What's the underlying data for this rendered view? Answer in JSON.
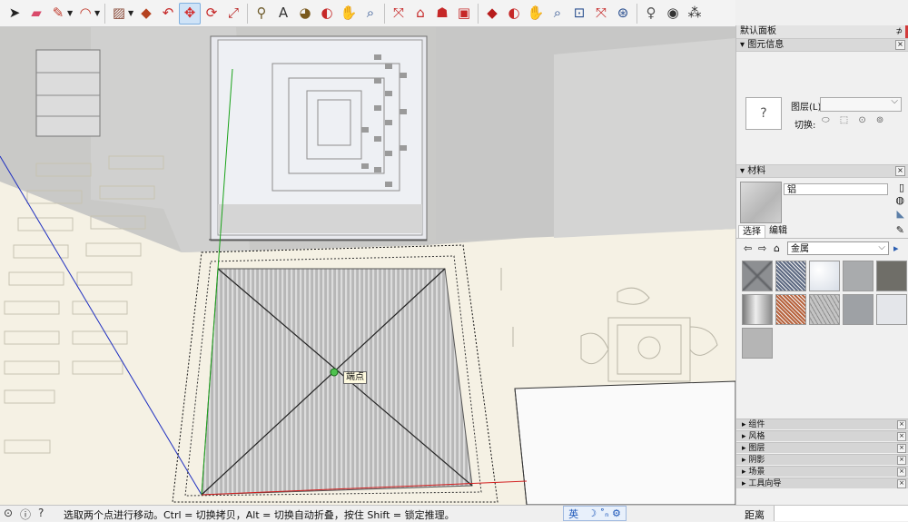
{
  "toolbar": {
    "tools": [
      {
        "name": "select-tool",
        "glyph": "➤",
        "color": "#222222"
      },
      {
        "name": "eraser-tool",
        "glyph": "▰",
        "color": "#d94a6a"
      },
      {
        "name": "pencil-tool",
        "glyph": "✎",
        "color": "#c0392b",
        "dropdown": true
      },
      {
        "name": "arc-tool",
        "glyph": "◠",
        "color": "#c0392b",
        "dropdown": true
      },
      {
        "name": "rectangle-tool",
        "glyph": "▨",
        "color": "#8a4b3a",
        "dropdown": true
      },
      {
        "name": "push-pull-tool",
        "glyph": "◆",
        "color": "#b5421f"
      },
      {
        "name": "offset-tool",
        "glyph": "↶",
        "color": "#c62828"
      },
      {
        "name": "move-tool",
        "glyph": "✥",
        "color": "#d32f2f",
        "active": true
      },
      {
        "name": "rotate-tool",
        "glyph": "⟳",
        "color": "#c62828"
      },
      {
        "name": "scale-tool",
        "glyph": "⤢",
        "color": "#b71c1c"
      },
      {
        "name": "tape-measure-tool",
        "glyph": "⚲",
        "color": "#6d5a2a"
      },
      {
        "name": "text-tool",
        "glyph": "A",
        "color": "#333333"
      },
      {
        "name": "paint-bucket-tool",
        "glyph": "◕",
        "color": "#7a5a1e"
      },
      {
        "name": "orbit-tool",
        "glyph": "◐",
        "color": "#c62828"
      },
      {
        "name": "pan-tool",
        "glyph": "✋",
        "color": "#b88b4a"
      },
      {
        "name": "zoom-tool",
        "glyph": "⌕",
        "color": "#2a4f8f"
      },
      {
        "name": "zoom-extents-tool",
        "glyph": "⤧",
        "color": "#c62828"
      },
      {
        "name": "warehouse-tool",
        "glyph": "⌂",
        "color": "#c62828"
      },
      {
        "name": "share-model-tool",
        "glyph": "☗",
        "color": "#c62828"
      },
      {
        "name": "extension-warehouse-tool",
        "glyph": "▣",
        "color": "#c62828"
      },
      {
        "name": "ruby-console-tool",
        "glyph": "◆",
        "color": "#b71c1c"
      },
      {
        "name": "orbit-tool-2",
        "glyph": "◐",
        "color": "#c62828"
      },
      {
        "name": "pan-tool-2",
        "glyph": "✋",
        "color": "#b88b4a"
      },
      {
        "name": "zoom-tool-2",
        "glyph": "⌕",
        "color": "#2a4f8f"
      },
      {
        "name": "zoom-window-tool",
        "glyph": "⊡",
        "color": "#2a4f8f"
      },
      {
        "name": "zoom-extents-tool-2",
        "glyph": "⤧",
        "color": "#c62828"
      },
      {
        "name": "previous-view-tool",
        "glyph": "⊛",
        "color": "#2a4f8f"
      },
      {
        "name": "position-camera-tool",
        "glyph": "♀",
        "color": "#555555"
      },
      {
        "name": "look-around-tool",
        "glyph": "◉",
        "color": "#333333"
      },
      {
        "name": "walk-tool",
        "glyph": "⁂",
        "color": "#333333"
      }
    ]
  },
  "viewport": {
    "inference_tooltip": "端点"
  },
  "panel": {
    "title": "默认面板",
    "pin": "⊅",
    "entity_info": {
      "header": "图元信息",
      "preview": "?",
      "layer_label": "图层(L):",
      "toggle_label": "切换:",
      "toggle_icons": "⬭ ⬚ ⊙ ⊚"
    },
    "materials": {
      "header": "材料",
      "name": "铝",
      "tab_select": "选择",
      "tab_edit": "编辑",
      "library": "金属",
      "swatches": [
        {
          "color": "#8d8f92",
          "pattern": "star"
        },
        {
          "color": "#5f6b83",
          "pattern": "noise"
        },
        {
          "color": "#d7dde6",
          "pattern": "frost"
        },
        {
          "color": "#a9abad",
          "pattern": "plain"
        },
        {
          "color": "#6f6e68",
          "pattern": "plain"
        },
        {
          "color": "#b9b9b9",
          "pattern": "cylinder"
        },
        {
          "color": "#b8643f",
          "pattern": "noise"
        },
        {
          "color": "#c4c4c4",
          "pattern": "tread"
        },
        {
          "color": "#9ea1a5",
          "pattern": "plain"
        },
        {
          "color": "#e4e6ea",
          "pattern": "plain"
        },
        {
          "color": "#b5b5b5",
          "pattern": "plain"
        }
      ]
    },
    "collapsed_trays": [
      "组件",
      "风格",
      "图层",
      "阴影",
      "场景",
      "工具向导"
    ]
  },
  "status": {
    "message": "选取两个点进行移动。Ctrl = 切换拷贝，Alt = 切换自动折叠，按住 Shift = 锁定推理。",
    "ime_label": "英",
    "ime_icons": "☽ ˚ₙ ⚙",
    "measure_label": "距离",
    "measure_value": ""
  }
}
